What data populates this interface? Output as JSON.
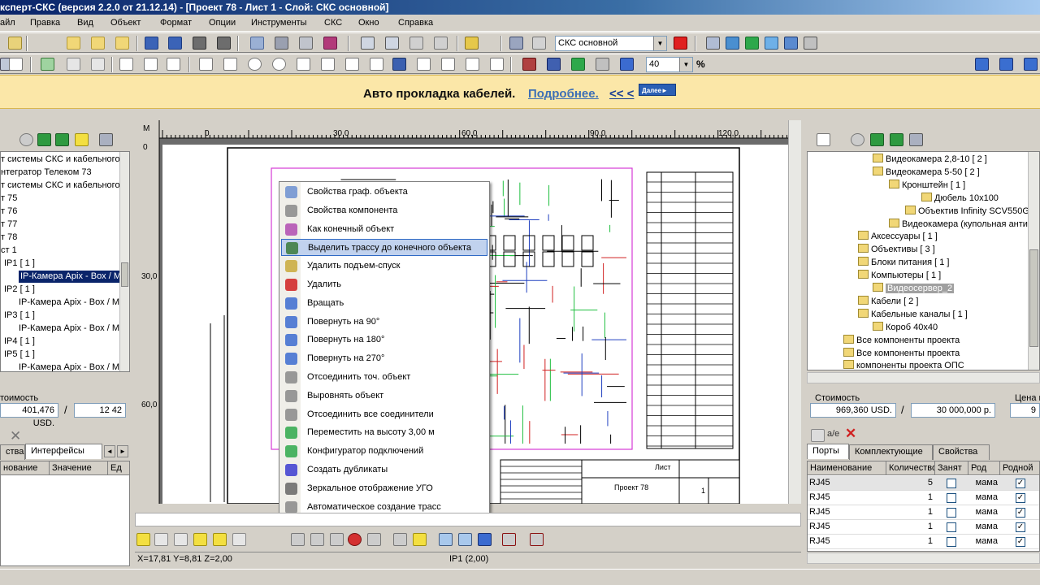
{
  "title": "ксперт-СКС (версия  2.2.0 от 21.12.14) - [Проект 78 - Лист 1 - Слой: СКС основной]",
  "menu": [
    "айл",
    "Правка",
    "Вид",
    "Объект",
    "Формат",
    "Опции",
    "Инструменты",
    "СКС",
    "Окно",
    "Справка"
  ],
  "toolbar": {
    "layer_combo": "СКС основной",
    "zoom_value": "40",
    "zoom_unit": "%"
  },
  "hint": {
    "text": "Авто прокладка кабелей.",
    "link": "Подробнее.",
    "back": "<< <",
    "next": "Далее►"
  },
  "left_panel": {
    "tree": [
      "т системы СКС и кабельного",
      "нтегратор Телеком 73",
      "т системы СКС и кабельного",
      "т 75",
      "т 76",
      "т 77",
      "т 78",
      "ст 1",
      "IP1  [ 1 ]",
      "IP-Камера Apix - Box / M",
      "IP2  [ 1 ]",
      "IP-Камера Apix - Box / M",
      "IP3  [ 1 ]",
      "IP-Камера Apix - Box / M",
      "IP4  [ 1 ]",
      "IP5  [ 1 ]",
      "IP-Камера Apix - Box / M"
    ],
    "cost_label": "тоимость",
    "cost_value": "401,476 USD.",
    "slash": "/",
    "cost_value2": "12 42",
    "tabs": [
      "ства",
      "Интерфейсы"
    ],
    "columns": [
      "нование",
      "Значение",
      "Ед"
    ]
  },
  "right_panel": {
    "tree": [
      "Видеокамера 2,8-10  [ 2 ]",
      "Видеокамера 5-50  [ 2 ]",
      "Кронштейн  [ 1 ]",
      "Дюбель 10x100",
      "Объектив Infinity SCV550G",
      "Видеокамера (купольная антиван",
      "Аксессуары  [ 1 ]",
      "Объективы  [ 3 ]",
      "Блоки питания  [ 1 ]",
      "Компьютеры  [ 1 ]",
      "Видеосервер_2",
      "Кабели  [ 2 ]",
      "Кабельные каналы  [ 1 ]",
      "Короб 40x40",
      "Все компоненты проекта",
      "Все компоненты проекта",
      "компоненты проекта ОПС"
    ],
    "cost_label": "Стоимость",
    "cost_usd": "969,360 USD.",
    "slash": "/",
    "cost_rub": "30 000,000 р.",
    "price_label": "Цена н",
    "price_value": "9",
    "tabs": [
      "Порты",
      "Комплектующие",
      "Свойства"
    ],
    "columns": [
      "Наименование",
      "Количество",
      "Занят",
      "Род",
      "Родной"
    ],
    "rows": [
      {
        "name": "RJ45",
        "qty": "5",
        "busy": false,
        "kind": "мама",
        "native": true
      },
      {
        "name": "RJ45",
        "qty": "1",
        "busy": false,
        "kind": "мама",
        "native": true
      },
      {
        "name": "RJ45",
        "qty": "1",
        "busy": false,
        "kind": "мама",
        "native": true
      },
      {
        "name": "RJ45",
        "qty": "1",
        "busy": false,
        "kind": "мама",
        "native": true
      },
      {
        "name": "RJ45",
        "qty": "1",
        "busy": false,
        "kind": "мама",
        "native": true
      }
    ]
  },
  "canvas": {
    "ruler_corner": "М",
    "ruler_x": [
      "0",
      "30,0",
      "60,0",
      "90,0",
      "120,0"
    ],
    "ruler_y": [
      "0",
      "30,0",
      "60,0"
    ],
    "title_block_sheet": "Лист",
    "title_block_project": "Проект 78",
    "title_block_number": "1"
  },
  "context_menu": [
    {
      "label": "Свойства граф. объекта",
      "icon": "properties-icon"
    },
    {
      "label": "Свойства компонента",
      "icon": "component-icon"
    },
    {
      "label": "Как конечный объект",
      "icon": "endpoint-icon"
    },
    {
      "label": "Выделить трассу до конечного объекта",
      "icon": "route-icon",
      "highlight": true
    },
    {
      "label": "Удалить подъем-спуск",
      "icon": "riser-icon"
    },
    {
      "label": "Удалить",
      "icon": "delete-icon"
    },
    {
      "label": "Вращать",
      "icon": "rotate-icon"
    },
    {
      "label": "Повернуть на 90°",
      "icon": "rotate-90-icon"
    },
    {
      "label": "Повернуть на 180°",
      "icon": "rotate-180-icon"
    },
    {
      "label": "Повернуть на 270°",
      "icon": "rotate-270-icon"
    },
    {
      "label": "Отсоединить точ. объект",
      "icon": "detach-icon"
    },
    {
      "label": "Выровнять объект",
      "icon": "align-icon"
    },
    {
      "label": "Отсоединить все соединители",
      "icon": "disconnect-icon"
    },
    {
      "label": "Переместить на высоту  3,00 м",
      "icon": "height-icon"
    },
    {
      "label": "Конфигуратор подключений",
      "icon": "configurator-icon"
    },
    {
      "label": "Создать дубликаты",
      "icon": "duplicate-icon"
    },
    {
      "label": "Зеркальное отображение УГО",
      "icon": "mirror-icon"
    },
    {
      "label": "Автоматическое создание трасс",
      "icon": "auto-route-icon"
    }
  ],
  "status": {
    "coords": "X=17,81  Y=8,81  Z=2,00",
    "object": "IP1 (2,00)"
  },
  "colors": {
    "title_bar": "#0a246a",
    "hint_bg": "#fbe7a8",
    "link": "#3d6fb5",
    "menu_highlight": "#c1d2ee"
  }
}
